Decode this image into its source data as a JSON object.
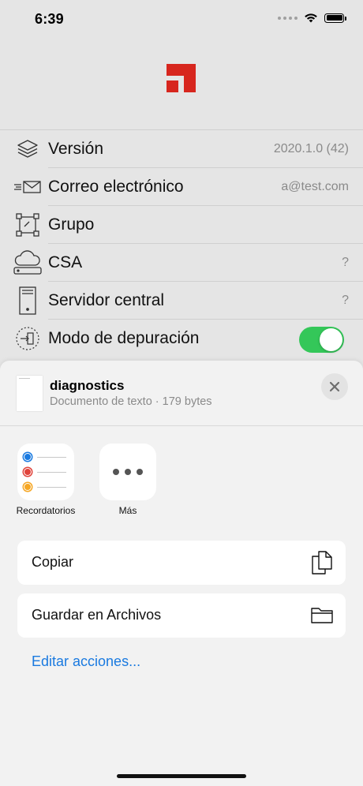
{
  "status_bar": {
    "time": "6:39"
  },
  "colors": {
    "brand_red": "#d7261e",
    "toggle_on": "#34c759",
    "link_blue": "#1a7ae0"
  },
  "settings": [
    {
      "label": "Versión",
      "value": "2020.1.0 (42)",
      "icon": "layers-icon"
    },
    {
      "label": "Correo electrónico",
      "value": "a@test.com",
      "icon": "mail-icon"
    },
    {
      "label": "Grupo",
      "value": "",
      "icon": "group-icon"
    },
    {
      "label": "CSA",
      "value": "?",
      "icon": "cloud-icon"
    },
    {
      "label": "Servidor central",
      "value": "?",
      "icon": "server-icon"
    },
    {
      "label": "Modo de depuración",
      "value": "",
      "icon": "debug-icon",
      "toggle_on": true
    }
  ],
  "share_sheet": {
    "title": "diagnostics",
    "subtitle": "Documento de texto · 179 bytes",
    "apps": [
      {
        "label": "Recordatorios",
        "icon": "reminders-icon"
      },
      {
        "label": "Más",
        "icon": "more-icon"
      }
    ],
    "actions": [
      {
        "label": "Copiar",
        "icon": "copy-icon"
      },
      {
        "label": "Guardar en Archivos",
        "icon": "folder-icon"
      }
    ],
    "edit_actions": "Editar acciones..."
  }
}
